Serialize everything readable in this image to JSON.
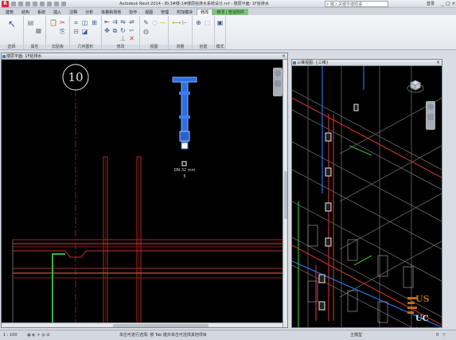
{
  "app": {
    "menu_letter": "R",
    "title": "Autodesk Revit 2014 - 四·3#楼-1#楼层给排水系统设计.rvt - 楼层平面: 1F给排水",
    "search_placeholder": "键入关键字或短语",
    "login": "登录",
    "window_buttons": [
      "_",
      "□",
      "×"
    ]
  },
  "tabs": [
    "建筑",
    "结构",
    "系统",
    "插入",
    "注释",
    "分析",
    "体量和场地",
    "协作",
    "视图",
    "管理",
    "附加模块",
    "修改",
    "修改 | 管道附件"
  ],
  "active_tab_index": 11,
  "context_tab_index": 12,
  "ribbon": {
    "panels": [
      "选择",
      "属性",
      "剪贴板",
      "几何图形",
      "修改",
      "视图",
      "测量",
      "创建",
      "模式"
    ]
  },
  "views": {
    "left_title": "楼层平面: 1F给排水",
    "right_title": "三维视图: {三维}",
    "grid_bubble": "10",
    "dimension_text": "DN 32 mm",
    "dimension_small": "5"
  },
  "status": {
    "scale": "1 : 100",
    "items": [
      "单击可进行选择; 按 Tab 键并单击可选择其他项目",
      "主模型"
    ],
    "zoom": "0"
  },
  "watermark": {
    "line1": "US",
    "line2": "UC"
  },
  "colors": {
    "pipe_blue": "#2f6fe0",
    "pipe_red": "#c0302a",
    "pipe_green": "#38b24a",
    "canvas_bg": "#000000"
  }
}
